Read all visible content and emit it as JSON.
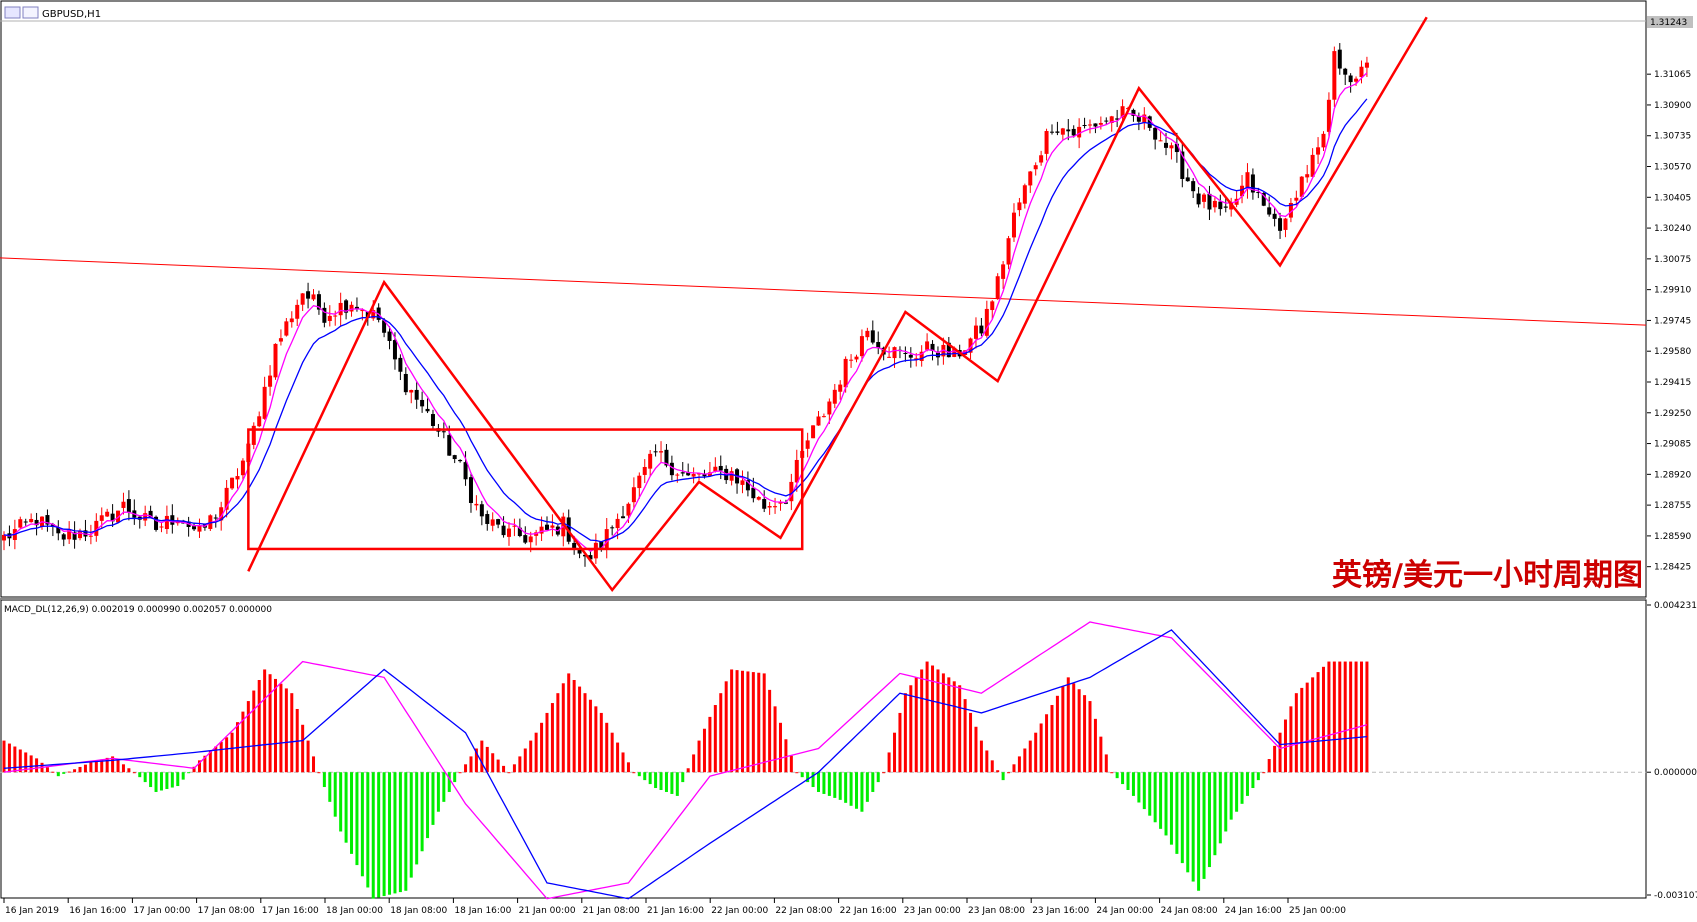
{
  "window": {
    "title": "GBPUSD,H1",
    "watermark": "英镑/美元一小时周期图"
  },
  "colors": {
    "bull": "#ff0000",
    "bear": "#000000",
    "ma_fast": "#ff00ff",
    "ma_slow": "#0000ff",
    "annotation": "#ff0000",
    "hist_pos": "#ff0000",
    "hist_neg": "#00ee00"
  },
  "chart_data": [
    {
      "type": "candlestick",
      "symbol": "GBPUSD",
      "timeframe": "H1",
      "price_labels": [
        "1.31243",
        "1.31065",
        "1.30900",
        "1.30735",
        "1.30570",
        "1.30405",
        "1.30240",
        "1.30075",
        "1.29910",
        "1.29745",
        "1.29580",
        "1.29415",
        "1.29250",
        "1.29085",
        "1.28920",
        "1.28755",
        "1.28590",
        "1.28425"
      ],
      "ylim": [
        1.283,
        1.3135
      ],
      "current_price": "1.31243",
      "time_labels": [
        "16 Jan 2019",
        "16 Jan 16:00",
        "17 Jan 00:00",
        "17 Jan 08:00",
        "17 Jan 16:00",
        "18 Jan 00:00",
        "18 Jan 08:00",
        "18 Jan 16:00",
        "21 Jan 00:00",
        "21 Jan 08:00",
        "21 Jan 16:00",
        "22 Jan 00:00",
        "22 Jan 08:00",
        "22 Jan 16:00",
        "23 Jan 00:00",
        "23 Jan 08:00",
        "23 Jan 16:00",
        "24 Jan 00:00",
        "24 Jan 08:00",
        "24 Jan 16:00",
        "25 Jan 00:00"
      ],
      "price_path": [
        [
          0,
          1.2858
        ],
        [
          6,
          1.2868
        ],
        [
          10,
          1.2858
        ],
        [
          16,
          1.2862
        ],
        [
          22,
          1.2875
        ],
        [
          28,
          1.2863
        ],
        [
          32,
          1.287
        ],
        [
          36,
          1.286
        ],
        [
          40,
          1.2875
        ],
        [
          45,
          1.2905
        ],
        [
          50,
          1.296
        ],
        [
          55,
          1.299
        ],
        [
          59,
          1.2978
        ],
        [
          64,
          1.2985
        ],
        [
          69,
          1.2975
        ],
        [
          73,
          1.2945
        ],
        [
          79,
          1.292
        ],
        [
          84,
          1.2895
        ],
        [
          88,
          1.2868
        ],
        [
          93,
          1.286
        ],
        [
          97,
          1.2858
        ],
        [
          103,
          1.2865
        ],
        [
          107,
          1.2845
        ],
        [
          110,
          1.2855
        ],
        [
          115,
          1.2878
        ],
        [
          120,
          1.2903
        ],
        [
          126,
          1.289
        ],
        [
          134,
          1.2893
        ],
        [
          140,
          1.2875
        ],
        [
          144,
          1.288
        ],
        [
          148,
          1.291
        ],
        [
          151,
          1.2925
        ],
        [
          155,
          1.295
        ],
        [
          159,
          1.297
        ],
        [
          162,
          1.296
        ],
        [
          166,
          1.2955
        ],
        [
          171,
          1.296
        ],
        [
          175,
          1.2955
        ],
        [
          180,
          1.297
        ],
        [
          183,
          1.2995
        ],
        [
          186,
          1.303
        ],
        [
          190,
          1.306
        ],
        [
          193,
          1.308
        ],
        [
          197,
          1.3075
        ],
        [
          201,
          1.308
        ],
        [
          206,
          1.3085
        ],
        [
          211,
          1.308
        ],
        [
          216,
          1.306
        ],
        [
          220,
          1.304
        ],
        [
          225,
          1.303
        ],
        [
          229,
          1.305
        ],
        [
          233,
          1.303
        ],
        [
          236,
          1.3025
        ],
        [
          238,
          1.3045
        ],
        [
          241,
          1.306
        ],
        [
          243,
          1.307
        ],
        [
          245,
          1.3115
        ],
        [
          247,
          1.311
        ],
        [
          249,
          1.31
        ],
        [
          251,
          1.3115
        ]
      ],
      "overlays": [
        {
          "type": "zigzag",
          "points": [
            [
              45,
              1.284
            ],
            [
              70,
              1.2995
            ],
            [
              112,
              1.283
            ],
            [
              128,
              1.2888
            ],
            [
              143,
              1.2858
            ],
            [
              166,
              1.2979
            ],
            [
              183,
              1.2942
            ],
            [
              209,
              1.3099
            ],
            [
              235,
              1.3004
            ],
            [
              262,
              1.3137
            ]
          ]
        },
        {
          "type": "rectangle",
          "x": [
            45,
            147
          ],
          "y": [
            1.2852,
            1.2916
          ]
        },
        {
          "type": "trendline",
          "points": [
            [
              0,
              1.3008
            ],
            [
              262,
              1.2972
            ]
          ]
        }
      ]
    },
    {
      "type": "macd",
      "label": "MACD_DL(12,26,9) 0.002019 0.000990 0.002057 0.000000",
      "ylim": [
        -0.003107,
        0.004231
      ],
      "scale_labels": [
        "0.004231",
        "0.000000",
        "-0.003107"
      ],
      "line_a_path": [
        [
          0,
          0.0
        ],
        [
          20,
          0.00035
        ],
        [
          35,
          0.0001
        ],
        [
          55,
          0.0028
        ],
        [
          70,
          0.0024
        ],
        [
          85,
          -0.0008
        ],
        [
          100,
          -0.0032
        ],
        [
          115,
          -0.0028
        ],
        [
          130,
          -0.0001
        ],
        [
          150,
          0.0006
        ],
        [
          165,
          0.0025
        ],
        [
          180,
          0.002
        ],
        [
          200,
          0.0038
        ],
        [
          215,
          0.0034
        ],
        [
          235,
          0.0006
        ],
        [
          251,
          0.0012
        ]
      ],
      "line_b_path": [
        [
          0,
          0.0001
        ],
        [
          20,
          0.0003
        ],
        [
          35,
          0.0005
        ],
        [
          55,
          0.0008
        ],
        [
          70,
          0.0026
        ],
        [
          85,
          0.001
        ],
        [
          100,
          -0.0028
        ],
        [
          115,
          -0.0032
        ],
        [
          130,
          -0.0018
        ],
        [
          150,
          0.0
        ],
        [
          165,
          0.002
        ],
        [
          180,
          0.0015
        ],
        [
          200,
          0.0024
        ],
        [
          215,
          0.0036
        ],
        [
          235,
          0.0007
        ],
        [
          251,
          0.0009
        ]
      ],
      "histogram_path": [
        [
          0,
          0.0008
        ],
        [
          6,
          0.00035
        ],
        [
          10,
          -0.0001
        ],
        [
          16,
          0.00025
        ],
        [
          20,
          0.0004
        ],
        [
          24,
          0.0
        ],
        [
          28,
          -0.0005
        ],
        [
          32,
          -0.00035
        ],
        [
          36,
          0.0003
        ],
        [
          42,
          0.001
        ],
        [
          48,
          0.0026
        ],
        [
          53,
          0.002
        ],
        [
          58,
          0.0
        ],
        [
          62,
          -0.0015
        ],
        [
          68,
          -0.0032
        ],
        [
          74,
          -0.003
        ],
        [
          80,
          -0.001
        ],
        [
          84,
          0.0
        ],
        [
          88,
          0.0008
        ],
        [
          93,
          0.0
        ],
        [
          98,
          0.001
        ],
        [
          104,
          0.0025
        ],
        [
          110,
          0.0015
        ],
        [
          116,
          0.0
        ],
        [
          120,
          -0.0004
        ],
        [
          124,
          -0.0006
        ],
        [
          128,
          0.0008
        ],
        [
          134,
          0.0026
        ],
        [
          140,
          0.0025
        ],
        [
          146,
          0.0
        ],
        [
          150,
          -0.0005
        ],
        [
          154,
          -0.0007
        ],
        [
          158,
          -0.001
        ],
        [
          162,
          0.0
        ],
        [
          166,
          0.002
        ],
        [
          170,
          0.0028
        ],
        [
          176,
          0.0022
        ],
        [
          180,
          0.0008
        ],
        [
          184,
          -0.0002
        ],
        [
          190,
          0.001
        ],
        [
          196,
          0.0024
        ],
        [
          200,
          0.0018
        ],
        [
          204,
          0.0
        ],
        [
          208,
          -0.0006
        ],
        [
          214,
          -0.0016
        ],
        [
          220,
          -0.003
        ],
        [
          226,
          -0.0012
        ],
        [
          232,
          0.0
        ],
        [
          238,
          0.002
        ],
        [
          244,
          0.0028
        ],
        [
          251,
          0.0028
        ]
      ]
    }
  ]
}
